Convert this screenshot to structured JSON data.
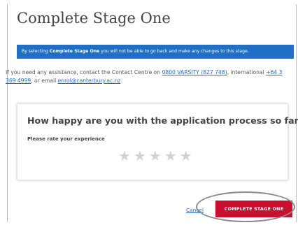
{
  "page": {
    "title": "Complete Stage One"
  },
  "notice": {
    "prefix": "By selecting ",
    "emphasis": "Complete Stage One",
    "suffix": " you will not be able to go back and make any changes to this stage."
  },
  "help": {
    "text_1": "If you need any assistance, contact the Contact Centre on ",
    "phone_link": "0800 VARSITY (827 748)",
    "text_2": ", international ",
    "intl_link": "+64 3 369 4999",
    "text_3": ", or email ",
    "email_link": "enrol@canterbury.ac.nz"
  },
  "feedback": {
    "question": "How happy are you with the application process so far?",
    "rate_label": "Please rate your experience",
    "stars": [
      "★",
      "★",
      "★",
      "★",
      "★"
    ],
    "selected_rating": 0
  },
  "actions": {
    "cancel_label": "Cancel",
    "complete_label": "COMPLETE STAGE ONE"
  },
  "colors": {
    "accent_blue": "#1f6fc5",
    "primary_red": "#c8102e",
    "star_empty": "#d3d3d3"
  }
}
